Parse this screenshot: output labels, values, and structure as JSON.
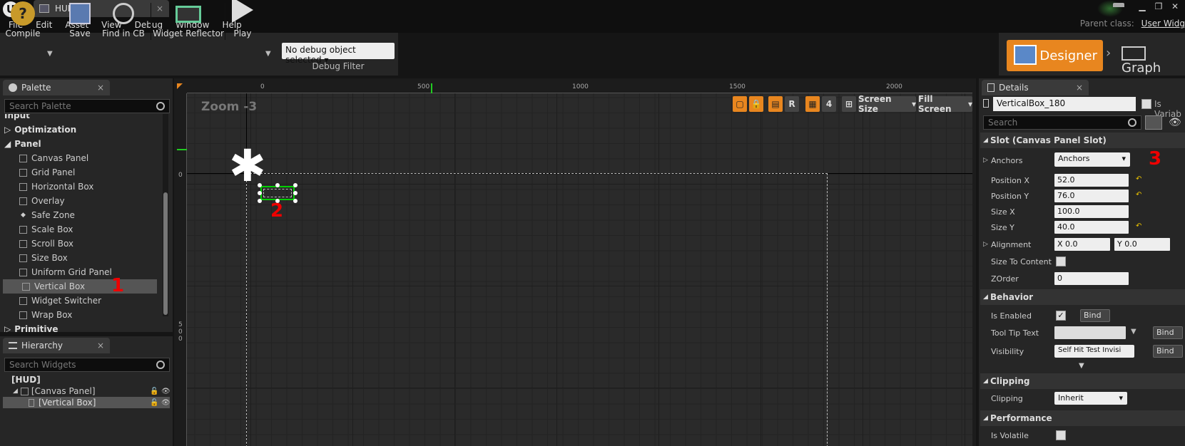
{
  "window": {
    "tab_title": "HUD*"
  },
  "menu": [
    "File",
    "Edit",
    "Asset",
    "View",
    "Debug",
    "Window",
    "Help"
  ],
  "parent_class": {
    "label": "Parent class:",
    "value": "User Widg"
  },
  "toolbar": {
    "compile": "Compile",
    "save": "Save",
    "find": "Find in CB",
    "reflector": "Widget Reflector",
    "play": "Play",
    "debug_object": "No debug object selected",
    "debug_filter": "Debug Filter"
  },
  "modes": {
    "designer": "Designer",
    "graph": "Graph"
  },
  "palette": {
    "tab": "Palette",
    "search_placeholder": "Search Palette",
    "categories": {
      "input": "Input",
      "optimization": "Optimization",
      "panel": "Panel",
      "primitive": "Primitive"
    },
    "items": [
      "Canvas Panel",
      "Grid Panel",
      "Horizontal Box",
      "Overlay",
      "Safe Zone",
      "Scale Box",
      "Scroll Box",
      "Size Box",
      "Uniform Grid Panel",
      "Vertical Box",
      "Widget Switcher",
      "Wrap Box"
    ]
  },
  "hierarchy": {
    "tab": "Hierarchy",
    "search_placeholder": "Search Widgets",
    "root": "[HUD]",
    "canvas": "[Canvas Panel]",
    "vbox": "[Vertical Box]"
  },
  "canvas": {
    "zoom": "Zoom -3",
    "ruler_top": [
      "0",
      "500",
      "1000",
      "1500",
      "2000"
    ],
    "ruler_left": [
      "0",
      "5",
      "0",
      "0"
    ],
    "btn_r": "R",
    "btn_4": "4",
    "screen_size": "Screen Size",
    "fill_screen": "Fill Screen"
  },
  "annotations": {
    "one": "1",
    "two": "2",
    "three": "3"
  },
  "details": {
    "tab": "Details",
    "name": "VerticalBox_180",
    "is_variable": "Is Variab",
    "search_placeholder": "Search",
    "slot_section": "Slot (Canvas Panel Slot)",
    "anchors_label": "Anchors",
    "anchors_value": "Anchors",
    "pos_x_label": "Position X",
    "pos_x": "52.0",
    "pos_y_label": "Position Y",
    "pos_y": "76.0",
    "size_x_label": "Size X",
    "size_x": "100.0",
    "size_y_label": "Size Y",
    "size_y": "40.0",
    "alignment_label": "Alignment",
    "align_x": "X  0.0",
    "align_y": "Y  0.0",
    "size_to_content": "Size To Content",
    "zorder_label": "ZOrder",
    "zorder": "0",
    "behavior": "Behavior",
    "is_enabled": "Is Enabled",
    "bind": "Bind",
    "tooltip": "Tool Tip Text",
    "visibility": "Visibility",
    "visibility_value": "Self Hit Test Invisi",
    "clipping_section": "Clipping",
    "clipping_label": "Clipping",
    "clipping_value": "Inherit",
    "performance": "Performance",
    "is_volatile": "Is Volatile"
  },
  "colors": {
    "accent": "#e8861f",
    "selection": "#00d000",
    "annotation": "#e00000"
  }
}
